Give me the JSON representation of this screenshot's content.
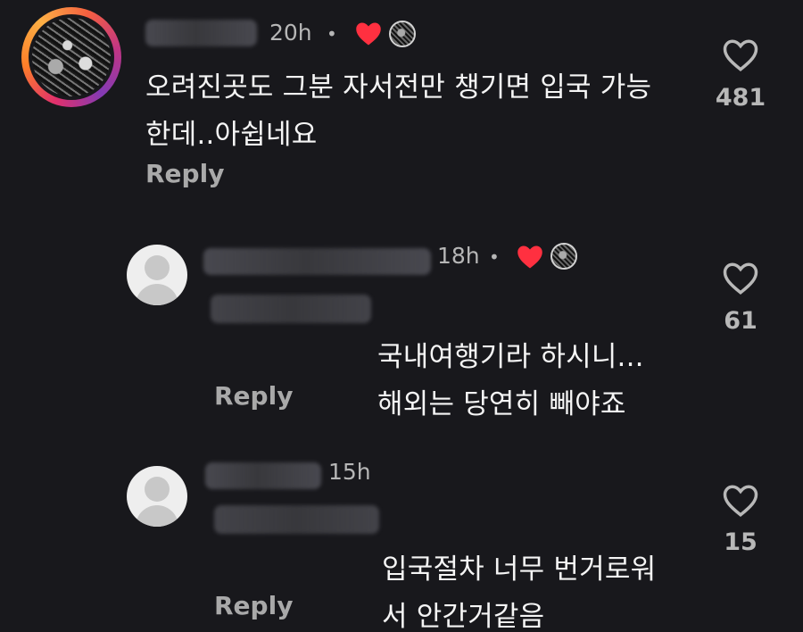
{
  "comments": [
    {
      "time": "20h",
      "dot": "•",
      "text": "오려진곳도 그분 자서전만 챙기면 입국 가능\n한데..아쉽네요",
      "reply_label": "Reply",
      "like_count": "481"
    },
    {
      "time": "18h",
      "dot": "•",
      "text": "국내여행기라 하시니...\n해외는 당연히 빼야죠",
      "reply_label": "Reply",
      "like_count": "61"
    },
    {
      "time": "15h",
      "text": "입국절차 너무 번거로워\n서 안간거같음",
      "reply_label": "Reply",
      "like_count": "15"
    }
  ],
  "icons": {
    "like": "heart-outline-icon",
    "creator_like": "heart-filled-icon",
    "default_avatar": "default-user-avatar-icon"
  },
  "colors": {
    "background": "#18181c",
    "primary_text": "#f5f5f5",
    "secondary_text": "#b6b6b6",
    "heart_red": "#ff3040"
  }
}
